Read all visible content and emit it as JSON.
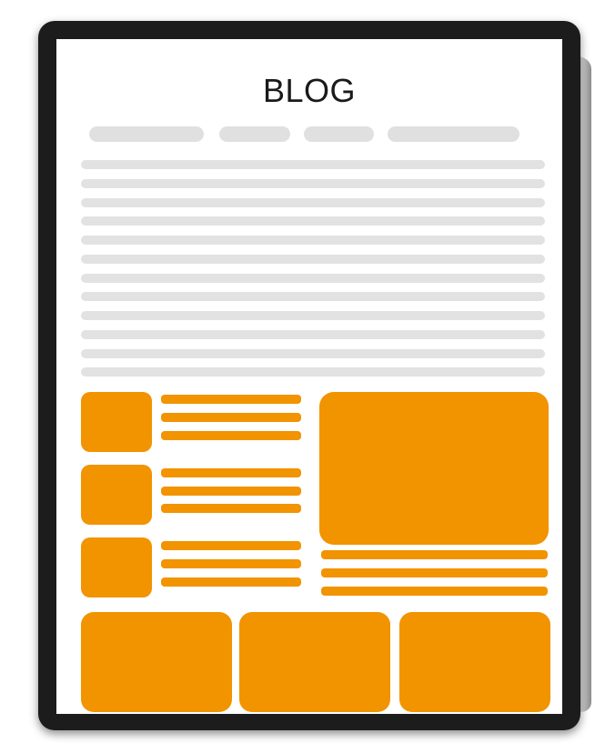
{
  "page": {
    "title": "BLOG"
  },
  "colors": {
    "accent": "#f29300",
    "placeholder": "#e0e0e0",
    "frame": "#1c1c1c"
  },
  "nav": {
    "items": [
      "nav-placeholder-1",
      "nav-placeholder-2",
      "nav-placeholder-3",
      "nav-placeholder-4"
    ]
  }
}
